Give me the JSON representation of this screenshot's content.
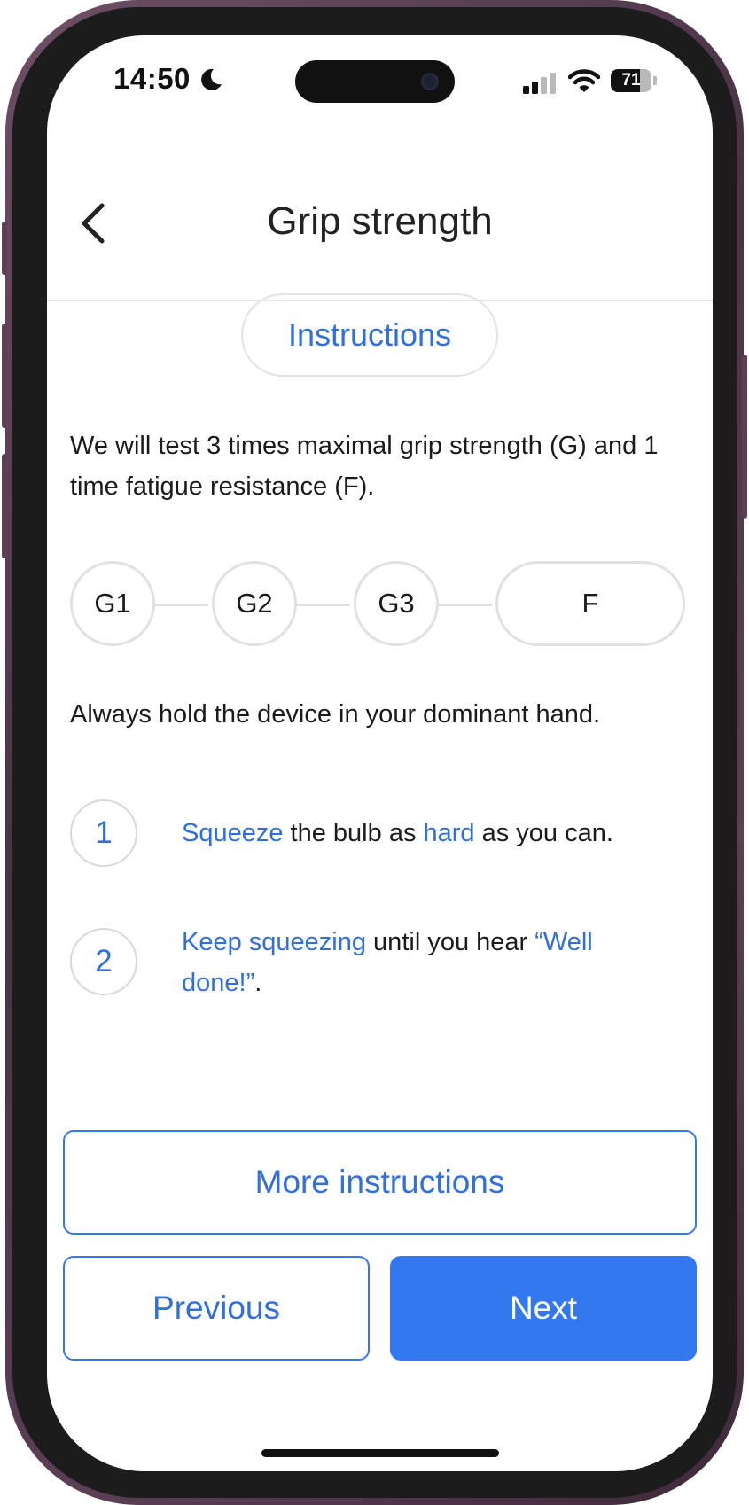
{
  "status_bar": {
    "time": "14:50",
    "battery_level": "71",
    "battery_fraction": 0.71,
    "icons": [
      "moon-icon",
      "signal-icon",
      "wifi-icon",
      "battery-icon"
    ]
  },
  "header": {
    "back_icon": "chevron-left-icon",
    "title": "Grip strength"
  },
  "section_pill": "Instructions",
  "intro_text": "We will test 3 times maximal grip strength (G) and 1 time fatigue resistance (F).",
  "steps": [
    "G1",
    "G2",
    "G3",
    "F"
  ],
  "dominant_hand_text": "Always hold the device in your dominant hand.",
  "instructions": [
    {
      "number": "1",
      "parts": [
        {
          "text": "Squeeze",
          "highlight": true
        },
        {
          "text": " the bulb as ",
          "highlight": false
        },
        {
          "text": "hard",
          "highlight": true
        },
        {
          "text": " as you can.",
          "highlight": false
        }
      ]
    },
    {
      "number": "2",
      "parts": [
        {
          "text": "Keep squeezing",
          "highlight": true
        },
        {
          "text": " until you hear ",
          "highlight": false
        },
        {
          "text": "“Well done!”",
          "highlight": true
        },
        {
          "text": ".",
          "highlight": false
        }
      ]
    }
  ],
  "buttons": {
    "more": "More instructions",
    "previous": "Previous",
    "next": "Next"
  },
  "colors": {
    "accent": "#3478f0",
    "text": "#1b1b1b",
    "frame": "#5b3f55"
  }
}
